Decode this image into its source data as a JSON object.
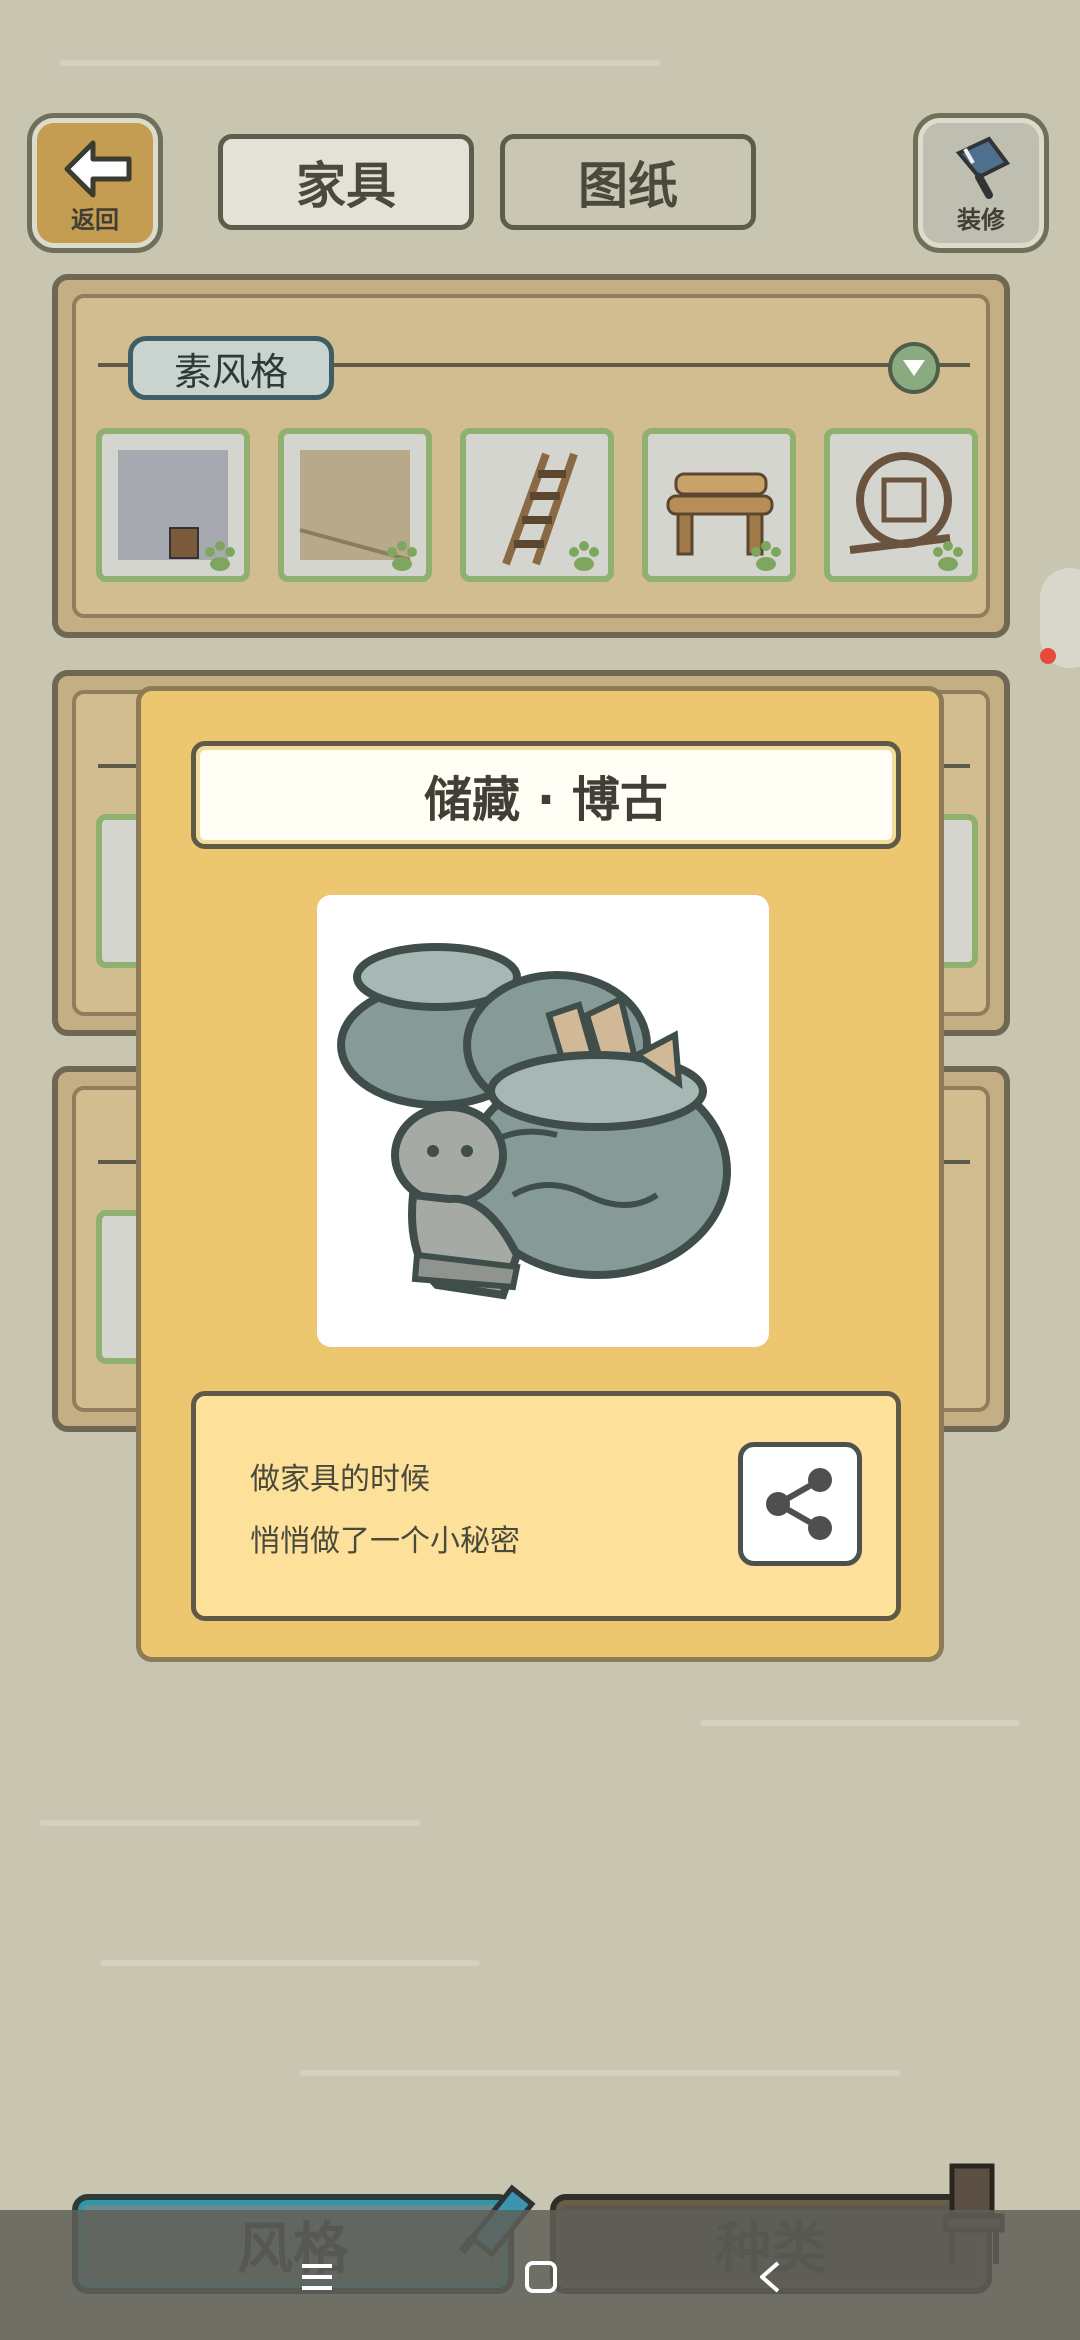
{
  "header": {
    "back_label": "返回",
    "tab_furniture": "家具",
    "tab_blueprint": "图纸",
    "decorate_label": "装修"
  },
  "style_panel": {
    "style_name": "素风格",
    "items": [
      {
        "icon": "wall-thumb-icon"
      },
      {
        "icon": "floor-thumb-icon"
      },
      {
        "icon": "ladder-thumb-icon"
      },
      {
        "icon": "log-bench-thumb-icon"
      },
      {
        "icon": "round-window-thumb-icon"
      }
    ]
  },
  "popup": {
    "title": "储藏 · 博古",
    "description_line1": "做家具的时候",
    "description_line2": "悄悄做了一个小秘密"
  },
  "bottom_tabs": {
    "style_label": "风格",
    "category_label": "种类"
  },
  "colors": {
    "background": "#c8c6b1",
    "popup": "#edc670",
    "accent_teal": "#3d5e64"
  }
}
